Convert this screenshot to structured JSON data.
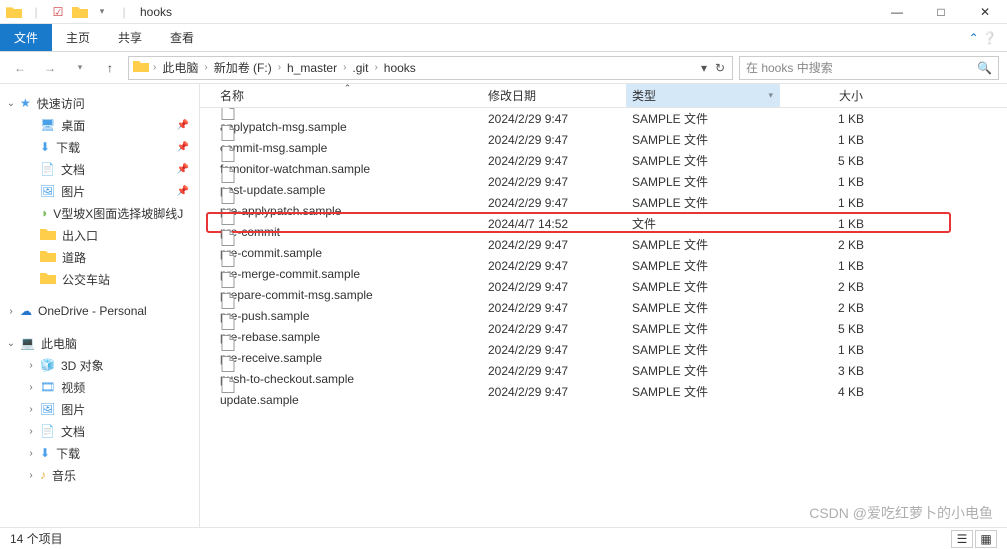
{
  "window": {
    "title": "hooks",
    "min": "—",
    "max": "□",
    "close": "✕"
  },
  "ribbon": {
    "file": "文件",
    "home": "主页",
    "share": "共享",
    "view": "查看"
  },
  "path": {
    "root": "此电脑",
    "crumbs": [
      "新加卷 (F:)",
      "h_master",
      ".git",
      "hooks"
    ]
  },
  "search": {
    "placeholder": "在 hooks 中搜索"
  },
  "sidebar": {
    "quick": "快速访问",
    "desktop": "桌面",
    "downloads": "下载",
    "documents": "文档",
    "pictures": "图片",
    "vslope": "V型坡X图面选择坡脚线J",
    "rukou": "出入口",
    "road": "道路",
    "bus": "公交车站",
    "onedrive": "OneDrive - Personal",
    "thispc": "此电脑",
    "objects3d": "3D 对象",
    "videos": "视频",
    "pictures2": "图片",
    "documents2": "文档",
    "downloads2": "下载",
    "music": "音乐"
  },
  "columns": {
    "name": "名称",
    "date": "修改日期",
    "type": "类型",
    "size": "大小"
  },
  "files": [
    {
      "name": "applypatch-msg.sample",
      "date": "2024/2/29 9:47",
      "type": "SAMPLE 文件",
      "size": "1 KB"
    },
    {
      "name": "commit-msg.sample",
      "date": "2024/2/29 9:47",
      "type": "SAMPLE 文件",
      "size": "1 KB"
    },
    {
      "name": "fsmonitor-watchman.sample",
      "date": "2024/2/29 9:47",
      "type": "SAMPLE 文件",
      "size": "5 KB"
    },
    {
      "name": "post-update.sample",
      "date": "2024/2/29 9:47",
      "type": "SAMPLE 文件",
      "size": "1 KB"
    },
    {
      "name": "pre-applypatch.sample",
      "date": "2024/2/29 9:47",
      "type": "SAMPLE 文件",
      "size": "1 KB"
    },
    {
      "name": "pre-commit",
      "date": "2024/4/7 14:52",
      "type": "文件",
      "size": "1 KB",
      "highlighted": true
    },
    {
      "name": "pre-commit.sample",
      "date": "2024/2/29 9:47",
      "type": "SAMPLE 文件",
      "size": "2 KB"
    },
    {
      "name": "pre-merge-commit.sample",
      "date": "2024/2/29 9:47",
      "type": "SAMPLE 文件",
      "size": "1 KB"
    },
    {
      "name": "prepare-commit-msg.sample",
      "date": "2024/2/29 9:47",
      "type": "SAMPLE 文件",
      "size": "2 KB"
    },
    {
      "name": "pre-push.sample",
      "date": "2024/2/29 9:47",
      "type": "SAMPLE 文件",
      "size": "2 KB"
    },
    {
      "name": "pre-rebase.sample",
      "date": "2024/2/29 9:47",
      "type": "SAMPLE 文件",
      "size": "5 KB"
    },
    {
      "name": "pre-receive.sample",
      "date": "2024/2/29 9:47",
      "type": "SAMPLE 文件",
      "size": "1 KB"
    },
    {
      "name": "push-to-checkout.sample",
      "date": "2024/2/29 9:47",
      "type": "SAMPLE 文件",
      "size": "3 KB"
    },
    {
      "name": "update.sample",
      "date": "2024/2/29 9:47",
      "type": "SAMPLE 文件",
      "size": "4 KB"
    }
  ],
  "status": {
    "count": "14 个项目"
  },
  "watermark": "CSDN @爱吃红萝卜的小电鱼"
}
